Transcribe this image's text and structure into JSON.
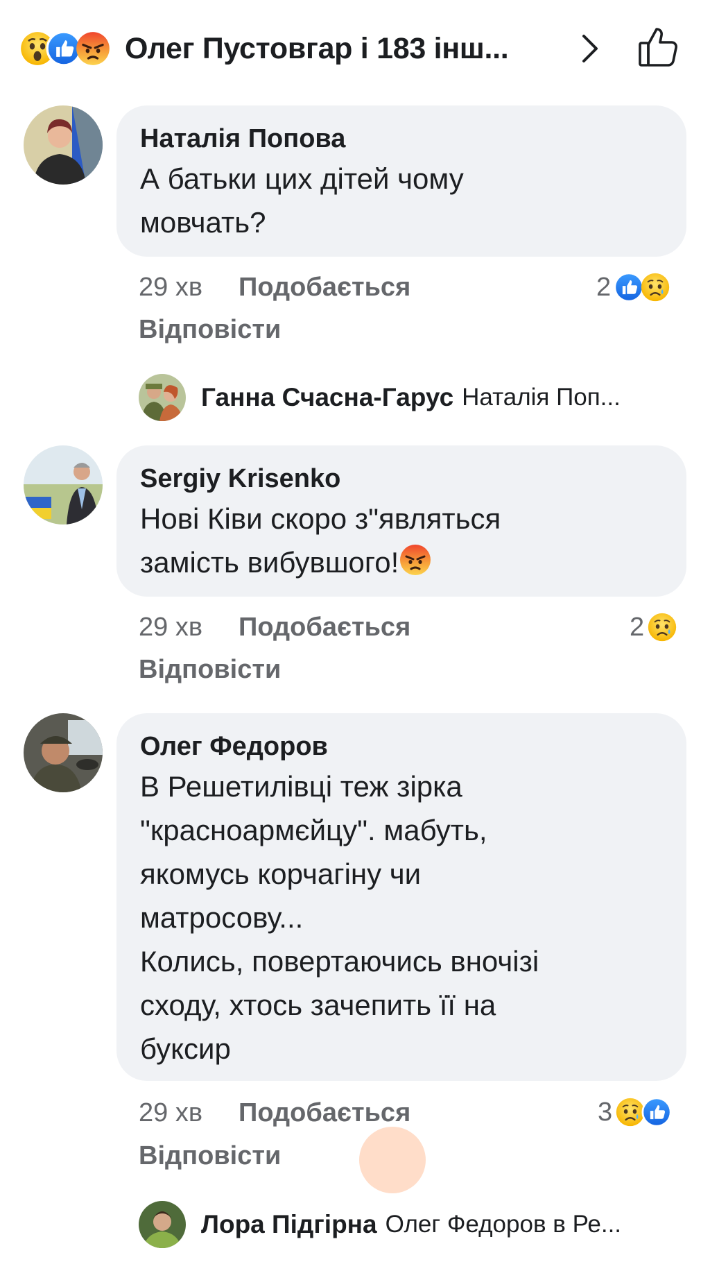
{
  "header": {
    "reactions": [
      "wow-emoji",
      "like-emoji",
      "angry-emoji"
    ],
    "title": "Олег Пустовгар і 183 інш...",
    "chevron_icon": "chevron-right-icon",
    "like_icon": "thumbs-up-outline-icon"
  },
  "comments": [
    {
      "author": "Наталія Попова",
      "text": "А батьки цих дітей чому\nмовчать?",
      "time": "29 хв",
      "like_label": "Подобається",
      "reply_label": "Відповісти",
      "reaction_count": "2",
      "reactions": [
        "like-emoji",
        "sad-emoji"
      ],
      "reply_preview": {
        "name": "Ганна Счасна-Гарус",
        "text": "Наталія Поп..."
      }
    },
    {
      "author": "Sergiy Krisenko",
      "text_line1": "Нові Ківи скоро з\"являться",
      "text_line2": "замість вибувшого!",
      "inline_emoji": "angry-emoji",
      "time": "29 хв",
      "like_label": "Подобається",
      "reply_label": "Відповісти",
      "reaction_count": "2",
      "reactions": [
        "sad-emoji"
      ]
    },
    {
      "author": "Олег Федоров",
      "text": "В Решетилівці теж зірка\n\"красноармєйцу\". мабуть,\nякомусь корчагіну чи\nматросову...\nКолись, повертаючись вночізі\nсходу, хтось зачепить її на\nбуксир",
      "time": "29 хв",
      "like_label": "Подобається",
      "reply_label": "Відповісти",
      "reaction_count": "3",
      "reactions": [
        "sad-emoji",
        "like-emoji"
      ],
      "reply_preview": {
        "name": "Лора Підгірна",
        "text": "Олег Федоров в Ре..."
      }
    }
  ],
  "colors": {
    "bubble": "#f0f2f5",
    "secondary_text": "#65676b",
    "like_blue": "#1877f2",
    "touch_indicator": "#ffd7bf"
  }
}
